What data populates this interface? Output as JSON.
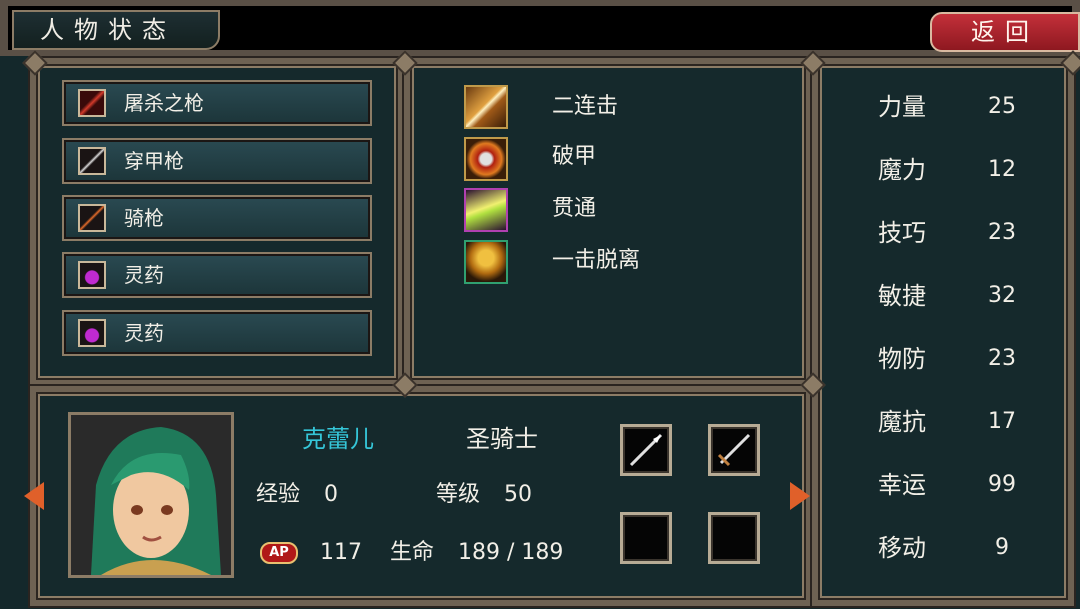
{
  "header": {
    "title": "人物状态",
    "back_label": "返回"
  },
  "items": [
    {
      "label": "屠杀之枪",
      "icon": "red-spear-icon"
    },
    {
      "label": "穿甲枪",
      "icon": "spear-icon"
    },
    {
      "label": "骑枪",
      "icon": "lance-icon"
    },
    {
      "label": "灵药",
      "icon": "potion-icon"
    },
    {
      "label": "灵药",
      "icon": "potion-icon"
    }
  ],
  "skills": [
    {
      "label": "二连击",
      "icon": "double-strike-icon"
    },
    {
      "label": "破甲",
      "icon": "armor-break-icon"
    },
    {
      "label": "贯通",
      "icon": "pierce-icon"
    },
    {
      "label": "一击脱离",
      "icon": "hit-and-run-icon"
    }
  ],
  "character": {
    "name": "克蕾儿",
    "class": "圣骑士",
    "exp_label": "经验",
    "exp": "0",
    "level_label": "等级",
    "level": "50",
    "ap_badge": "AP",
    "ap": "117",
    "hp_label": "生命",
    "hp": "189 / 189"
  },
  "stats": [
    {
      "name": "力量",
      "value": "25"
    },
    {
      "name": "魔力",
      "value": "12"
    },
    {
      "name": "技巧",
      "value": "23"
    },
    {
      "name": "敏捷",
      "value": "32"
    },
    {
      "name": "物防",
      "value": "23"
    },
    {
      "name": "魔抗",
      "value": "17"
    },
    {
      "name": "幸运",
      "value": "99"
    },
    {
      "name": "移动",
      "value": "9"
    }
  ],
  "colors": {
    "name_color": "#35c6d8",
    "back_button": "#b82630",
    "frame": "#6e6253"
  }
}
